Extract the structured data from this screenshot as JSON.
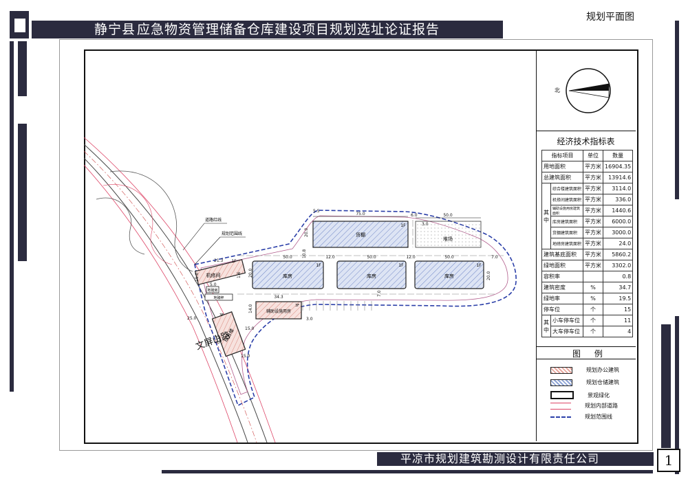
{
  "header": {
    "title_first": "静宁县",
    "title_rest": "应急物资管理储备仓库建设项目规划选址论证报告",
    "page_label": "规划平面图"
  },
  "compass": {
    "north": "北"
  },
  "table": {
    "title": "经济技术指标表",
    "headers": [
      "指标项目",
      "单位",
      "数量"
    ],
    "rows": [
      {
        "item": "用地面积",
        "unit": "平方米",
        "value": "16904.35"
      },
      {
        "item": "总建筑面积",
        "unit": "平方米",
        "value": "13914.6"
      },
      {
        "group": "其中",
        "item": "综合楼建筑面积",
        "unit": "平方米",
        "value": "3114.0"
      },
      {
        "item": "机修间建筑面积",
        "unit": "平方米",
        "value": "336.0"
      },
      {
        "item": "辅助设施用房建筑面积",
        "unit": "平方米",
        "value": "1440.6"
      },
      {
        "item": "库房建筑面积",
        "unit": "平方米",
        "value": "6000.0"
      },
      {
        "item": "货棚建筑面积",
        "unit": "平方米",
        "value": "3000.0"
      },
      {
        "item": "地磅房建筑面积",
        "unit": "平方米",
        "value": "24.0"
      },
      {
        "item": "建筑基底面积",
        "unit": "平方米",
        "value": "5860.2"
      },
      {
        "item": "绿地面积",
        "unit": "平方米",
        "value": "3302.0"
      },
      {
        "item": "容积率",
        "unit": "",
        "value": "0.8"
      },
      {
        "item": "建筑密度",
        "unit": "%",
        "value": "34.7"
      },
      {
        "item": "绿地率",
        "unit": "%",
        "value": "19.5"
      },
      {
        "item": "停车位",
        "unit": "个",
        "value": "15"
      },
      {
        "group": "其中",
        "item": "小车停车位",
        "unit": "个",
        "value": "11"
      },
      {
        "item": "大车停车位",
        "unit": "个",
        "value": "4"
      }
    ]
  },
  "legend": {
    "title": "图 例",
    "items": [
      {
        "label": "规划办公建筑",
        "color": "#e8a9a0"
      },
      {
        "label": "规划仓储建筑",
        "color": "#8fa5d6"
      },
      {
        "label": "景观绿化",
        "color": "#ffffff"
      },
      {
        "label": "规划内部道路",
        "color": "#ffffff"
      },
      {
        "label": "规划范围线",
        "color": "#2a3ea8"
      }
    ]
  },
  "plan": {
    "road_name": "文屏山路",
    "callout_redline": "道路红线",
    "callout_boundary": "规划范围线",
    "buildings": {
      "shed": "货棚",
      "yard": "堆场",
      "warehouse": "库房",
      "repair": "机修间",
      "scale_house": "地磅房",
      "scale": "地磅秤",
      "aux": "辅助设施用房",
      "office": "综合楼"
    },
    "floors": {
      "f1": "1F",
      "f3": "3F"
    },
    "dims": {
      "d75": "75.0",
      "d50": "50.0",
      "d6": "6.0",
      "d3": "3.0",
      "d20": "20.0",
      "d55": "5.5",
      "d12": "12.0",
      "d7": "7.0",
      "d108": "10.8",
      "d343": "34.3",
      "d14": "14.0",
      "d15": "15.0",
      "d25": "25.0",
      "d5": "5.0",
      "d15b": "15.0",
      "d24": "24.0",
      "d213": "21.3",
      "d16": "1.6"
    }
  },
  "footer": {
    "company": "平凉市规划建筑勘测设计有限责任公司",
    "page": "1"
  }
}
